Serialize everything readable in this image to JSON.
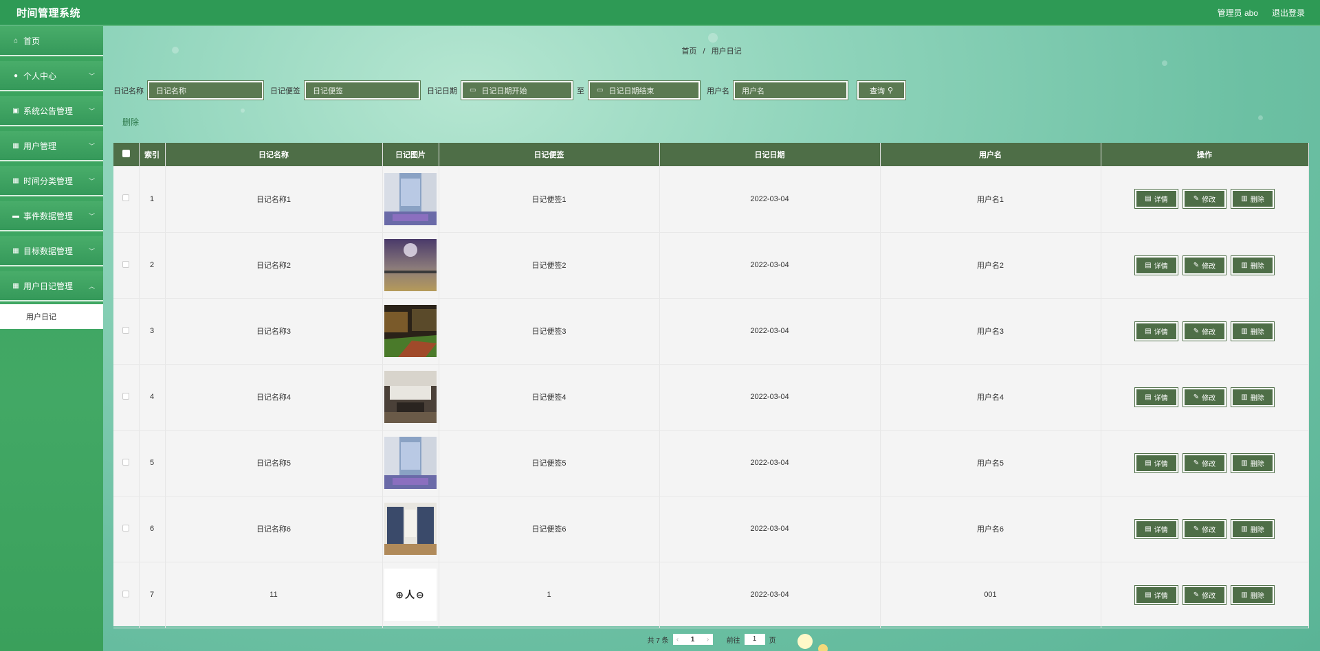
{
  "app": {
    "title": "时间管理系统",
    "user_label": "管理员 abo",
    "logout_label": "退出登录"
  },
  "sidebar": {
    "items": [
      {
        "label": "首页",
        "icon": "home-icon"
      },
      {
        "label": "个人中心",
        "icon": "user-icon"
      },
      {
        "label": "系统公告管理",
        "icon": "clipboard-icon"
      },
      {
        "label": "用户管理",
        "icon": "grid-icon"
      },
      {
        "label": "时间分类管理",
        "icon": "grid-icon"
      },
      {
        "label": "事件数据管理",
        "icon": "chat-icon"
      },
      {
        "label": "目标数据管理",
        "icon": "grid-icon"
      },
      {
        "label": "用户日记管理",
        "icon": "grid-icon"
      }
    ],
    "sub_item": "用户日记"
  },
  "breadcrumb": {
    "home": "首页",
    "sep": "/",
    "current": "用户日记"
  },
  "search": {
    "name_label": "日记名称",
    "name_placeholder": "日记名称",
    "tag_label": "日记便签",
    "tag_placeholder": "日记便签",
    "date_label": "日记日期",
    "date_start_placeholder": "日记日期开始",
    "date_to": "至",
    "date_end_placeholder": "日记日期结束",
    "user_label": "用户名",
    "user_placeholder": "用户名",
    "query_label": "查询"
  },
  "bulk_delete_label": "删除",
  "table": {
    "headers": {
      "index": "索引",
      "name": "日记名称",
      "image": "日记图片",
      "tag": "日记便签",
      "date": "日记日期",
      "user": "用户名",
      "ops": "操作"
    },
    "rows": [
      {
        "index": "1",
        "name": "日记名称1",
        "tag": "日记便签1",
        "date": "2022-03-04",
        "user": "用户名1"
      },
      {
        "index": "2",
        "name": "日记名称2",
        "tag": "日记便签2",
        "date": "2022-03-04",
        "user": "用户名2"
      },
      {
        "index": "3",
        "name": "日记名称3",
        "tag": "日记便签3",
        "date": "2022-03-04",
        "user": "用户名3"
      },
      {
        "index": "4",
        "name": "日记名称4",
        "tag": "日记便签4",
        "date": "2022-03-04",
        "user": "用户名4"
      },
      {
        "index": "5",
        "name": "日记名称5",
        "tag": "日记便签5",
        "date": "2022-03-04",
        "user": "用户名5"
      },
      {
        "index": "6",
        "name": "日记名称6",
        "tag": "日记便签6",
        "date": "2022-03-04",
        "user": "用户名6"
      },
      {
        "index": "7",
        "name": "11",
        "tag": "1",
        "date": "2022-03-04",
        "user": "001"
      }
    ],
    "row7_image_text": "⊕人⊖",
    "actions": {
      "detail": "详情",
      "edit": "修改",
      "delete": "删除"
    }
  },
  "pager": {
    "total": "共 7 条",
    "current_page": "1",
    "goto_label": "前往",
    "goto_value": "1",
    "page_suffix": "页"
  },
  "colors": {
    "topbar": "#2e9a55",
    "button": "#4e6e47",
    "sidebar": "#3aa35d"
  }
}
